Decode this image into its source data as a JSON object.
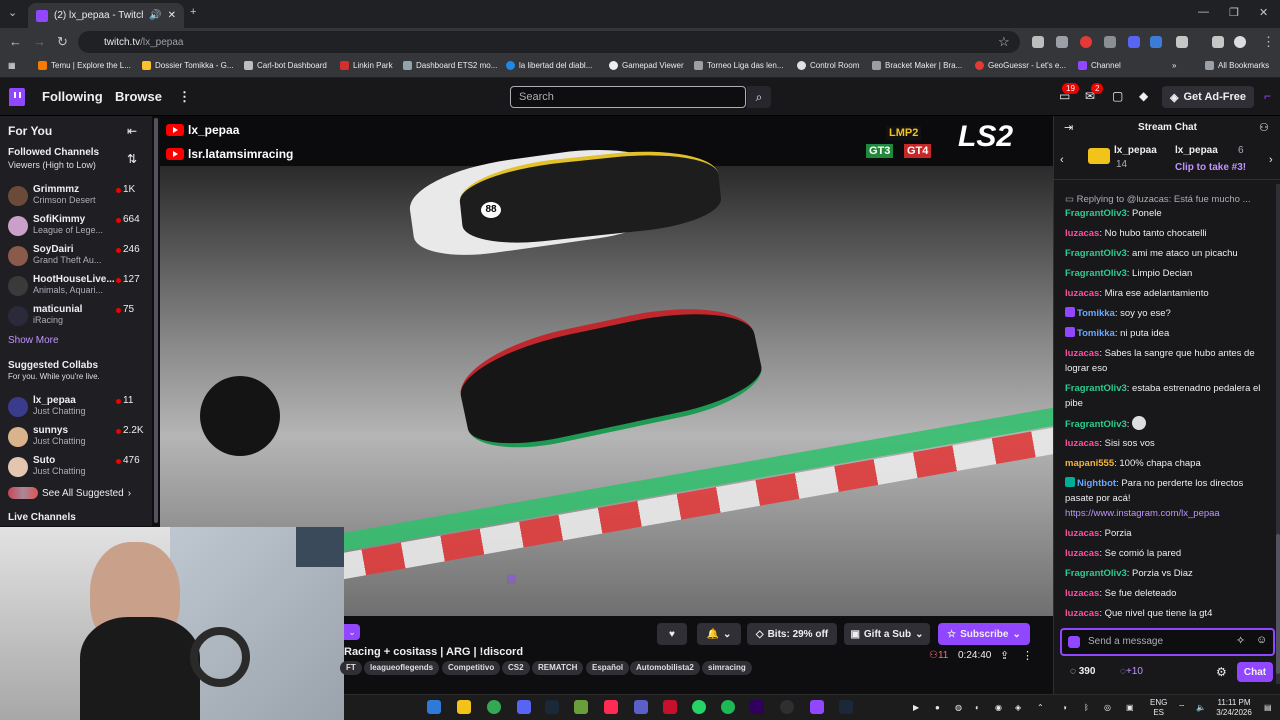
{
  "browser": {
    "tab_title": "(2) lx_pepaa - Twitch",
    "url_host": "twitch.tv",
    "url_path": "/lx_pepaa",
    "bookmarks": [
      "Temu | Explore the L...",
      "Dossier Tomikka - G...",
      "Carl-bot Dashboard",
      "Linkin Park",
      "Dashboard ETS2 mo...",
      "la libertad del diabl...",
      "Gamepad Viewer",
      "Torneo Liga das len...",
      "Control Room",
      "Bracket Maker | Bra...",
      "GeoGuessr - Let's e...",
      "Channel"
    ],
    "all_bookmarks": "All Bookmarks"
  },
  "topnav": {
    "following": "Following",
    "browse": "Browse",
    "search_placeholder": "Search",
    "inbox_count": "19",
    "notif_count": "2",
    "ad_free": "Get Ad-Free"
  },
  "sidebar": {
    "for_you": "For You",
    "followed_title": "Followed Channels",
    "followed_sort": "Viewers (High to Low)",
    "followed": [
      {
        "name": "Grimmmz",
        "game": "Crimson Desert",
        "viewers": "1K"
      },
      {
        "name": "SofiKimmy",
        "game": "League of Lege...",
        "viewers": "664"
      },
      {
        "name": "SoyDairi",
        "game": "Grand Theft Au...",
        "viewers": "246"
      },
      {
        "name": "HootHouseLive...",
        "game": "Animals, Aquari...",
        "viewers": "127"
      },
      {
        "name": "maticunial",
        "game": "iRacing",
        "viewers": "75"
      }
    ],
    "show_more": "Show More",
    "collabs_title": "Suggested Collabs",
    "collabs_sub": "For you. While you're live.",
    "collabs": [
      {
        "name": "lx_pepaa",
        "game": "Just Chatting",
        "viewers": "11"
      },
      {
        "name": "sunnys",
        "game": "Just Chatting",
        "viewers": "2.2K"
      },
      {
        "name": "Suto",
        "game": "Just Chatting",
        "viewers": "476"
      }
    ],
    "see_all": "See All Suggested",
    "live_channels": "Live Channels"
  },
  "video": {
    "overlay_1": "lx_pepaa",
    "overlay_2": "lsr.latamsimracing",
    "class_1": "LMP2",
    "class_2": "GT3",
    "class_3": "GT4",
    "logo": "LS2",
    "car_number": "88"
  },
  "info": {
    "title": "Racing + cositass | ARG | !discord",
    "tags": [
      "FT",
      "leagueoflegends",
      "Competitivo",
      "CS2",
      "REMATCH",
      "Español",
      "Automobilista2",
      "simracing"
    ],
    "bits": "Bits: 29% off",
    "gift": "Gift a Sub",
    "subscribe": "Subscribe",
    "viewers": "11",
    "uptime": "0:24:40"
  },
  "chat": {
    "header": "Stream Chat",
    "pinned_user1": "lx_pepaa",
    "pinned_count1": "14",
    "pinned_user2": "lx_pepaa",
    "pinned_count2": "6",
    "pinned_text": "Clip to take #3!",
    "replying": "Replying to @luzacas: Está fue mucho ...",
    "messages": [
      {
        "user": "FragrantOliv3",
        "text": ": Ponele"
      },
      {
        "user": "luzacas",
        "text": ": No hubo tanto chocatelli"
      },
      {
        "user": "FragrantOliv3",
        "text": ": ami me ataco un picachu"
      },
      {
        "user": "FragrantOliv3",
        "text": ": Limpio Decian"
      },
      {
        "user": "luzacas",
        "text": ": Mira ese adelantamiento"
      },
      {
        "user": "Tomikka",
        "text": ": soy yo ese?"
      },
      {
        "user": "Tomikka",
        "text": ": ni puta idea"
      },
      {
        "user": "luzacas",
        "text": ": Sabes la sangre que hubo antes de lograr eso"
      },
      {
        "user": "FragrantOliv3",
        "text": ": estaba estrenadno pedalera el pibe"
      },
      {
        "user": "FragrantOliv3",
        "text": ":"
      },
      {
        "user": "luzacas",
        "text": ": Sisi sos vos"
      },
      {
        "user": "mapani555",
        "text": ": 100% chapa chapa"
      },
      {
        "user": "Nightbot",
        "text": ": Para no perderte los directos pasate por acá!"
      },
      {
        "user": "luzacas",
        "text": ": Porzia"
      },
      {
        "user": "luzacas",
        "text": ": Se comió la pared"
      },
      {
        "user": "FragrantOliv3",
        "text": ": Porzia vs Diaz"
      },
      {
        "user": "luzacas",
        "text": ": Se fue deleteado"
      },
      {
        "user": "luzacas",
        "text": ": Que nivel que tiene la gt4"
      }
    ],
    "link": "https://www.instagram.com/lx_pepaa",
    "input_placeholder": "Send a message",
    "points": "390",
    "points_bonus": "+10",
    "send": "Chat"
  },
  "taskbar": {
    "lang1": "ENG",
    "lang2": "ES",
    "time": "11:11 PM",
    "date": "3/24/2026"
  },
  "colors": {
    "twitch_purple": "#9146ff",
    "live_red": "#eb0400",
    "bg": "#0e0e10"
  }
}
